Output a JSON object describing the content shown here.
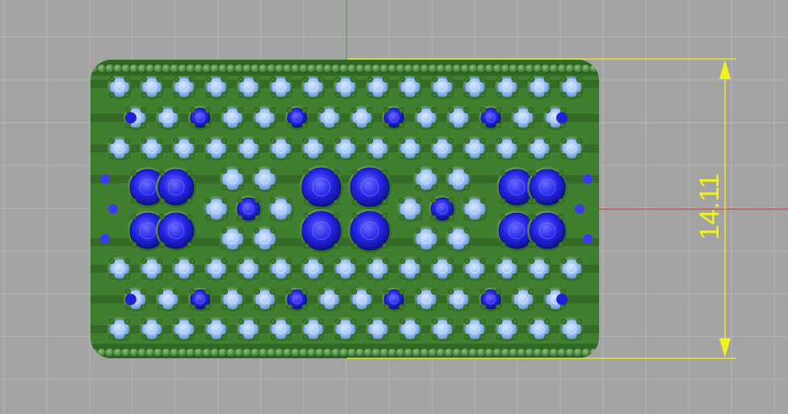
{
  "viewport": {
    "dimension": {
      "value": "14.11",
      "color": "#f2f21c"
    },
    "axes": {
      "x_color": "#c83232",
      "y_color": "#3c9c3c"
    },
    "model": {
      "metal_color": "#3f7f2f",
      "stone_light_color": "#8fb8f0",
      "stone_dark_color": "#1c1ce0"
    }
  }
}
